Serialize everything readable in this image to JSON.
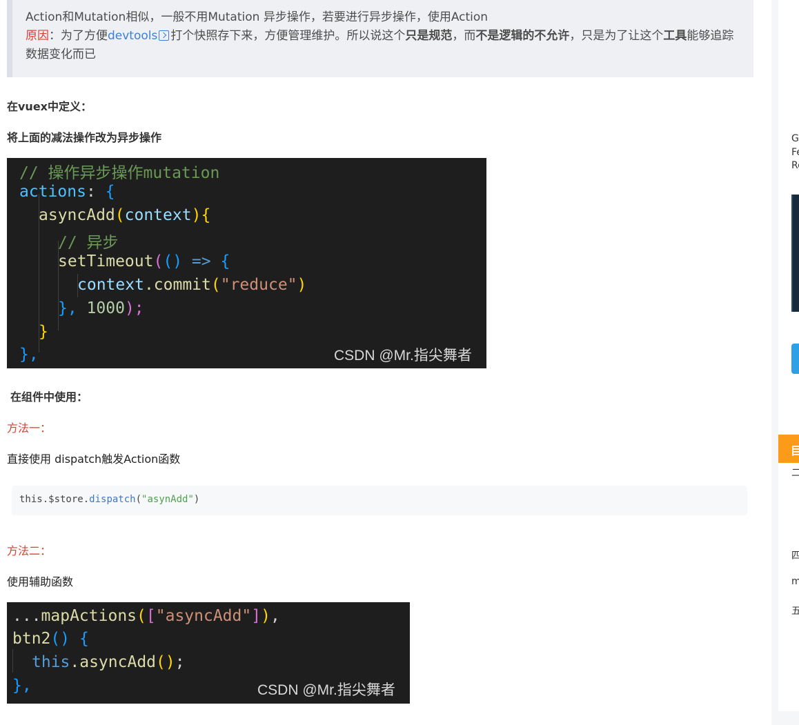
{
  "note": {
    "line1": "Action和Mutation相似，一般不用Mutation 异步操作，若要进行异步操作，使用Action",
    "reason_label": "原因",
    "reason_sep": "：为了方便",
    "devtools_link": "devtools",
    "after_link": "打个快照存下来，方便管理维护。所以说这个",
    "bold1": "只是规范",
    "mid1": "，而",
    "bold2": "不是逻辑的不允许",
    "mid2": "，只是为了让这个",
    "bold3": "工具",
    "end": "能够追踪数据变化而已"
  },
  "headings": {
    "define_in_vuex": "在vuex中定义：",
    "change_to_async": "将上面的减法操作改为异步操作",
    "use_in_component": "在组件中使用："
  },
  "method1": {
    "label": "方法一：",
    "desc": "直接使用  dispatch触发Action函数"
  },
  "method2": {
    "label": "方法二：",
    "desc": "使用辅助函数"
  },
  "codebox": {
    "part_this": "this",
    "part_store": ".$store.",
    "part_fn": "dispatch",
    "part_open": "(",
    "part_str": "\"asynAdd\"",
    "part_close": ")"
  },
  "code_image_1": {
    "comment1": "// 操作异步操作mutation",
    "actions": "actions",
    "colon_brace": ": ",
    "brace_open": "{",
    "fn_name": "asyncAdd",
    "paren_open": "(",
    "param": "context",
    "paren_close": ")",
    "comment2": "// 异步",
    "settimeout": "setTimeout",
    "arrow_parens": "()",
    "arrow": " => ",
    "context": "context",
    "dot_commit": ".commit",
    "str_reduce": "\"reduce\"",
    "close_brace_comma": "}, ",
    "num": "1000",
    "end_call": ");",
    "close1": "}",
    "close2": "},",
    "watermark": "CSDN @Mr.指尖舞者"
  },
  "code_image_2": {
    "spread": "...",
    "map_fn": "mapActions",
    "arr_str": "\"asyncAdd\"",
    "btn": "btn2",
    "this_kw": "this",
    "call": ".asyncAdd",
    "close": "},",
    "watermark": "CSDN @Mr.指尖舞者"
  },
  "sidebar": {
    "t1": "G",
    "t2": "Fe",
    "t3": "Re",
    "orange": "目",
    "t4": "二",
    "t5": "四",
    "t6": "m",
    "t7": "五"
  }
}
